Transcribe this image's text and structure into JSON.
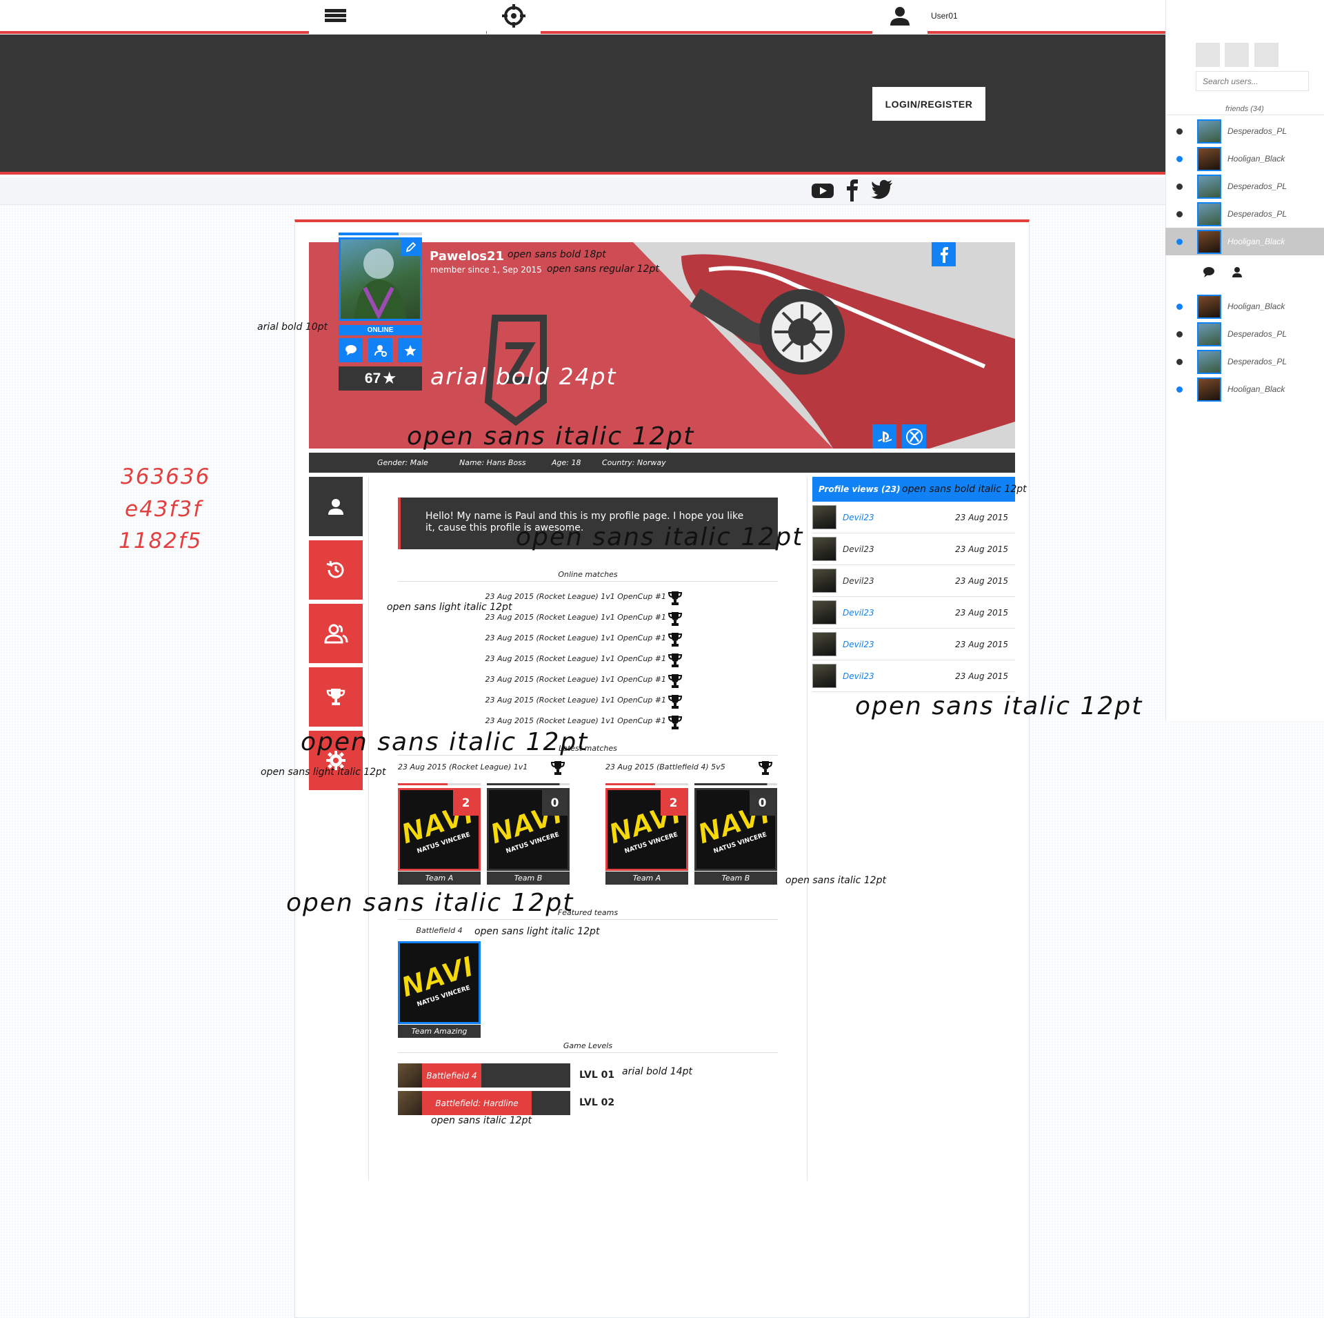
{
  "colors": {
    "dark": "#363636",
    "red": "#e43f3f",
    "blue": "#1182f5"
  },
  "topbar": {
    "menu_icon": "hamburger-icon",
    "target_icon": "crosshair-icon",
    "user_icon": "user-icon",
    "username": "User01",
    "chat_icon": "chat-icon"
  },
  "hero": {
    "login_label": "LOGIN/REGISTER"
  },
  "social": [
    "youtube-icon",
    "facebook-icon",
    "twitter-icon"
  ],
  "sidebar": {
    "search_placeholder": "Search users...",
    "friends_label": "friends (34)",
    "friends": [
      {
        "name": "Desperados_PL",
        "status": "offline"
      },
      {
        "name": "Hooligan_Black",
        "status": "online"
      },
      {
        "name": "Desperados_PL",
        "status": "offline"
      },
      {
        "name": "Desperados_PL",
        "status": "offline"
      },
      {
        "name": "Hooligan_Black",
        "status": "online",
        "selected": true
      }
    ],
    "friends2": [
      {
        "name": "Hooligan_Black",
        "status": "online"
      },
      {
        "name": "Desperados_PL",
        "status": "offline"
      },
      {
        "name": "Desperados_PL",
        "status": "offline"
      },
      {
        "name": "Hooligan_Black",
        "status": "online"
      }
    ]
  },
  "profile": {
    "username": "Pawelos21",
    "member_since": "member since 1, Sep 2015",
    "status": "ONLINE",
    "rating": "67",
    "gender": "Gender: Male",
    "name": "Name: Hans Boss",
    "age": "Age: 18",
    "country": "Country: Norway",
    "bio": "Hello! My name is Paul and this is my profile page. I hope you like it, cause this profile is awesome."
  },
  "sections": {
    "online_matches": "Online matches",
    "latest_matches": "Latest matches",
    "featured_teams": "Featured teams",
    "game_levels": "Game Levels"
  },
  "online_matches": [
    "23 Aug 2015 (Rocket League) 1v1 OpenCup #1",
    "23 Aug 2015 (Rocket League) 1v1 OpenCup #1",
    "23 Aug 2015 (Rocket League) 1v1 OpenCup #1",
    "23 Aug 2015 (Rocket League) 1v1 OpenCup #1",
    "23 Aug 2015 (Rocket League) 1v1 OpenCup #1",
    "23 Aug 2015 (Rocket League) 1v1 OpenCup #1",
    "23 Aug 2015 (Rocket League) 1v1 OpenCup #1"
  ],
  "latest_matches": [
    {
      "title": "23 Aug 2015 (Rocket League) 1v1",
      "team_a": "Team A",
      "team_b": "Team B",
      "score_a": "2",
      "score_b": "0"
    },
    {
      "title": "23 Aug 2015 (Battlefield 4) 5v5",
      "team_a": "Team A",
      "team_b": "Team B",
      "score_a": "2",
      "score_b": "0"
    }
  ],
  "featured": {
    "game": "Battlefield 4",
    "team": "Team Amazing"
  },
  "logo_text": {
    "main": "NAVI",
    "sub": "NATUS VINCERE"
  },
  "game_levels": [
    {
      "game": "Battlefield 4",
      "level": "LVL 01",
      "progress": 0.4
    },
    {
      "game": "Battlefield: Hardline",
      "level": "LVL 02",
      "progress": 0.74
    }
  ],
  "profile_views": {
    "title": "Profile views (23)",
    "rows": [
      {
        "name": "Devil23",
        "date": "23 Aug 2015",
        "highlight": true
      },
      {
        "name": "Devil23",
        "date": "23 Aug 2015",
        "highlight": false
      },
      {
        "name": "Devil23",
        "date": "23 Aug 2015",
        "highlight": false
      },
      {
        "name": "Devil23",
        "date": "23 Aug 2015",
        "highlight": true
      },
      {
        "name": "Devil23",
        "date": "23 Aug 2015",
        "highlight": true
      },
      {
        "name": "Devil23",
        "date": "23 Aug 2015",
        "highlight": true
      }
    ]
  },
  "annotations": {
    "a1": "open sans bold 18pt",
    "a2": "open sans regular 12pt",
    "a3": "arial bold 10pt",
    "a4": "arial bold 24pt",
    "a5": "open sans italic 12pt",
    "a6": "363636",
    "a7": "e43f3f",
    "a8": "1182f5",
    "a9": "open sans italic 12pt",
    "a10": "open sans light italic 12pt",
    "a11": "open sans italic 12pt",
    "a12": "open sans light italic 12pt",
    "a13": "open sans italic 12pt",
    "a14": "open sans italic 12pt",
    "a15": "open sans light italic 12pt",
    "a16": "arial bold 14pt",
    "a17": "open sans italic 12pt",
    "a18": "open sans bold italic 12pt",
    "a19": "open sans italic 12pt"
  }
}
